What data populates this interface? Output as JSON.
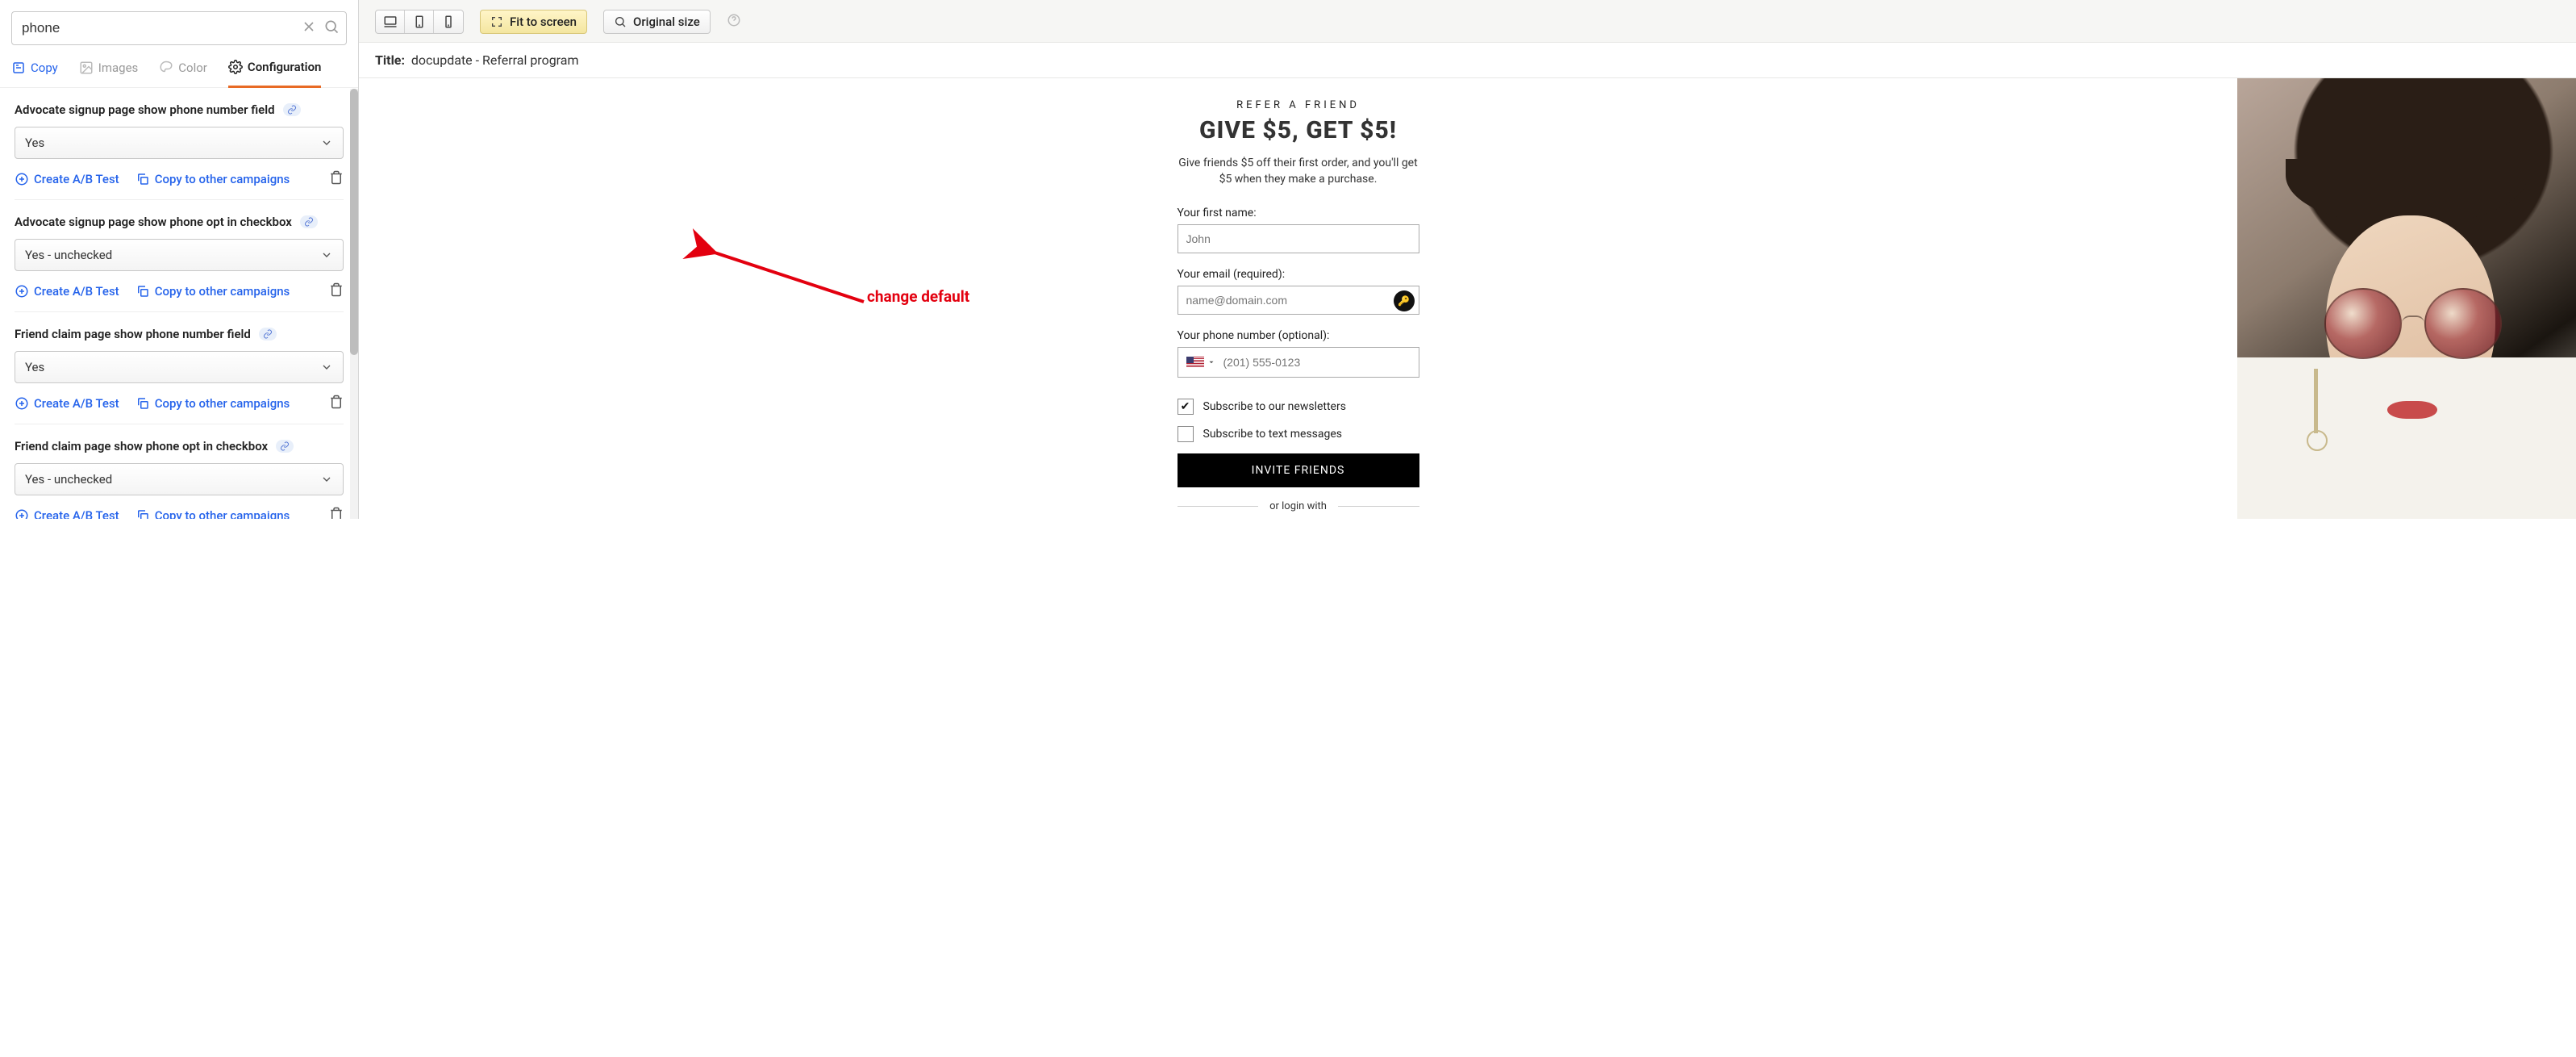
{
  "sidebar": {
    "search_value": "phone",
    "tabs": {
      "copy": "Copy",
      "images": "Images",
      "color": "Color",
      "configuration": "Configuration"
    },
    "items": [
      {
        "title": "Advocate signup page show phone number field",
        "value": "Yes",
        "create_ab": "Create A/B Test",
        "copy_to": "Copy to other campaigns"
      },
      {
        "title": "Advocate signup page show phone opt in checkbox",
        "value": "Yes - unchecked",
        "create_ab": "Create A/B Test",
        "copy_to": "Copy to other campaigns"
      },
      {
        "title": "Friend claim page show phone number field",
        "value": "Yes",
        "create_ab": "Create A/B Test",
        "copy_to": "Copy to other campaigns"
      },
      {
        "title": "Friend claim page show phone opt in checkbox",
        "value": "Yes - unchecked",
        "create_ab": "Create A/B Test",
        "copy_to": "Copy to other campaigns"
      }
    ]
  },
  "toolbar": {
    "fit": "Fit to screen",
    "original": "Original size"
  },
  "title_bar": {
    "label": "Title:",
    "value": "docupdate - Referral program"
  },
  "form": {
    "eyebrow": "REFER A FRIEND",
    "headline": "GIVE $5, GET $5!",
    "subhead": "Give friends $5 off their first order, and you'll get $5 when they make a purchase.",
    "first_name_label": "Your first name:",
    "first_name_placeholder": "John",
    "email_label": "Your email (required):",
    "email_placeholder": "name@domain.com",
    "phone_label": "Your phone number (optional):",
    "phone_placeholder": "(201) 555-0123",
    "newsletter": "Subscribe to our newsletters",
    "sms": "Subscribe to text messages",
    "cta": "INVITE FRIENDS",
    "login": "or login with"
  },
  "annotation": {
    "text": "change default"
  }
}
